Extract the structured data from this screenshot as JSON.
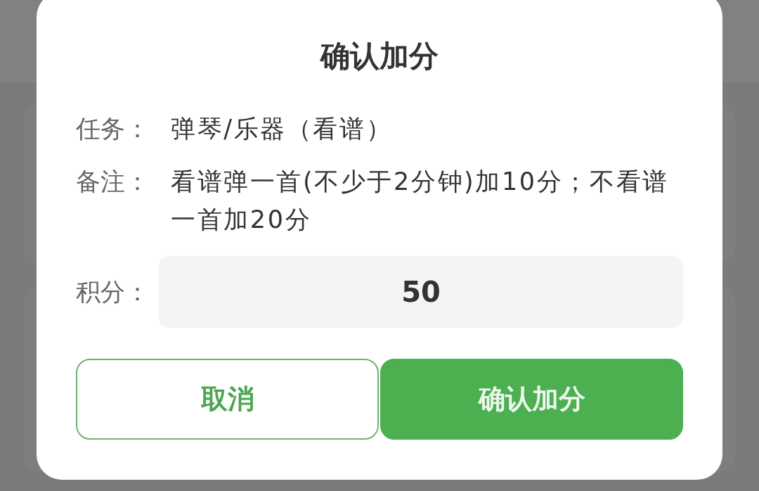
{
  "dialog": {
    "title": "确认加分",
    "fields": [
      {
        "label": "任务：",
        "value": "弹琴/乐器（看谱）"
      },
      {
        "label": "备注：",
        "value": "看谱弹一首(不少于2分钟)加10分；不看谱一首加20分"
      }
    ],
    "score": {
      "label": "积分：",
      "value": "50"
    },
    "buttons": [
      {
        "label": "取消",
        "kind": "secondary"
      },
      {
        "label": "确认加分",
        "kind": "primary"
      }
    ]
  }
}
